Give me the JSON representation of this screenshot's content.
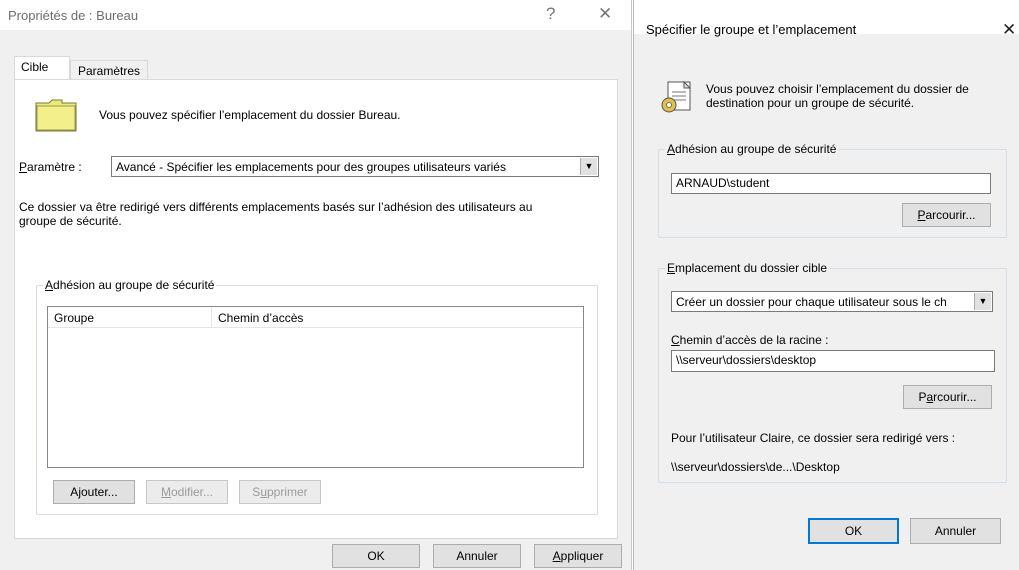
{
  "left_dialog": {
    "title": "Propriétés de : Bureau",
    "help": "?",
    "close": "✕",
    "tabs": [
      "Cible",
      "Paramètres"
    ],
    "intro": "Vous pouvez spécifier l’emplacement du dossier Bureau.",
    "setting_label": "Paramètre :",
    "setting_value": "Avancé - Spécifier les emplacements pour des groupes utilisateurs variés",
    "description_1": "Ce dossier va être redirigé vers différents emplacements basés sur l’adhésion des utilisateurs au",
    "description_2": "groupe de sécurité.",
    "group_title": "Adhésion au groupe de sécurité",
    "table_headers": [
      "Groupe",
      "Chemin d’accès"
    ],
    "add": "Ajouter...",
    "modify": "Modifier...",
    "delete": "Supprimer",
    "ok": "OK",
    "cancel": "Annuler",
    "apply": "Appliquer"
  },
  "right_dialog": {
    "title": "Spécifier le groupe et l’emplacement",
    "close": "✕",
    "intro_1": "Vous pouvez choisir l’emplacement du dossier de",
    "intro_2": "destination pour un groupe de sécurité.",
    "group1_title": "Adhésion au groupe de sécurité",
    "group_value": "ARNAUD\\student",
    "browse1": "Parcourir...",
    "group2_title": "Emplacement du dossier cible",
    "location_value": "Créer un dossier pour chaque utilisateur sous le ch",
    "root_label": "Chemin d’accès de la racine :",
    "root_value": "\\\\serveur\\dossiers\\desktop",
    "browse2": "Parcourir...",
    "preview_label": "Pour l’utilisateur Claire, ce dossier sera redirigé vers :",
    "preview_value": "\\\\serveur\\dossiers\\de...\\Desktop",
    "ok": "OK",
    "cancel": "Annuler"
  }
}
